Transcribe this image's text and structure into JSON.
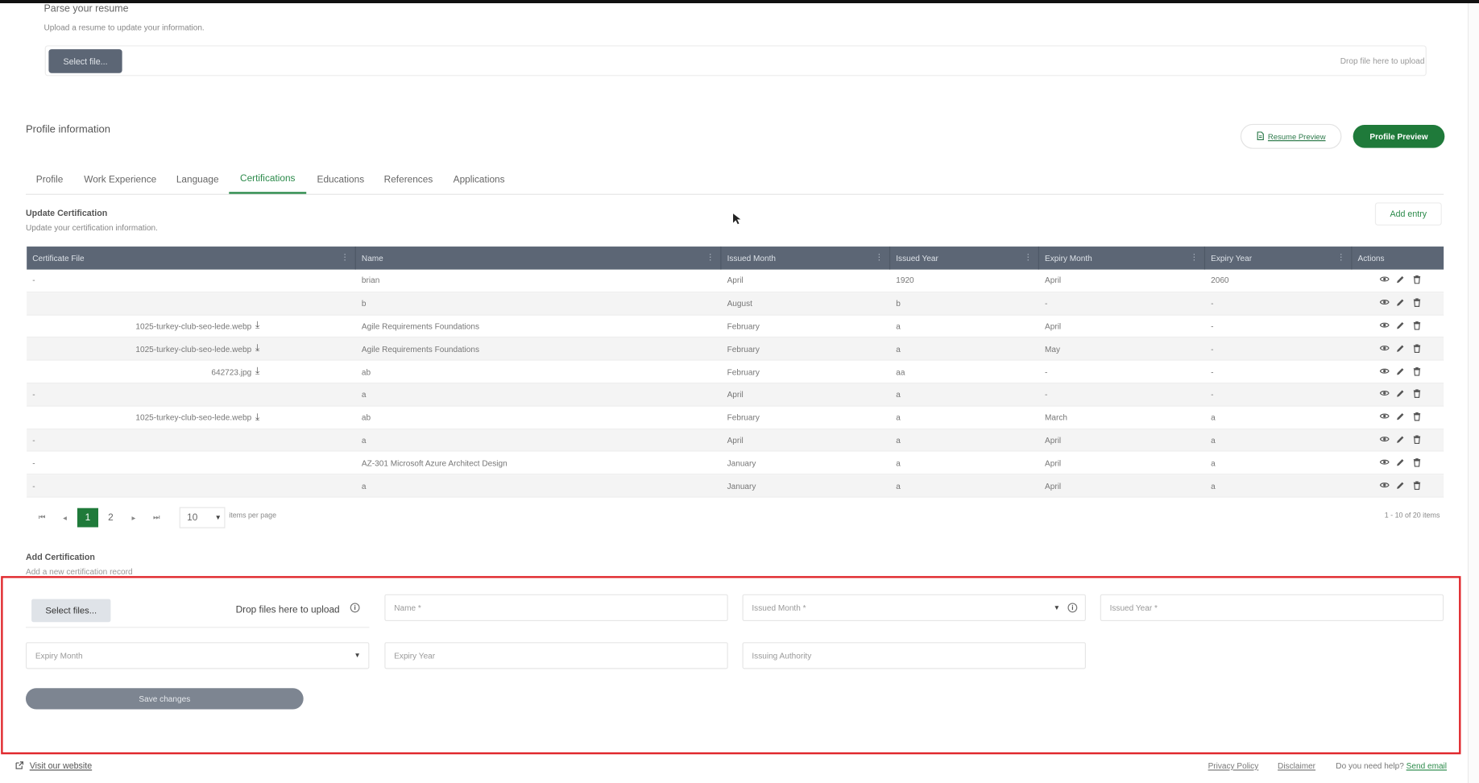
{
  "parse": {
    "title": "Parse your resume",
    "subtitle": "Upload a resume to update your information.",
    "select_label": "Select file...",
    "drop_label": "Drop file here to upload"
  },
  "profile": {
    "title": "Profile information",
    "resume_preview": "Resume Preview",
    "profile_preview": "Profile Preview"
  },
  "tabs": [
    "Profile",
    "Work Experience",
    "Language",
    "Certifications",
    "Educations",
    "References",
    "Applications"
  ],
  "active_tab": "Certifications",
  "update": {
    "title": "Update Certification",
    "subtitle": "Update your certification information.",
    "add_entry": "Add entry"
  },
  "table": {
    "columns": [
      "Certificate File",
      "Name",
      "Issued Month",
      "Issued Year",
      "Expiry Month",
      "Expiry Year",
      "Actions"
    ],
    "rows": [
      {
        "file": "-",
        "name": "brian",
        "issued_month": "April",
        "issued_year": "1920",
        "expiry_month": "April",
        "expiry_year": "2060"
      },
      {
        "file": "",
        "name": "b",
        "issued_month": "August",
        "issued_year": "b",
        "expiry_month": "-",
        "expiry_year": "-"
      },
      {
        "file": "1025-turkey-club-seo-lede.webp",
        "name": "Agile Requirements Foundations",
        "issued_month": "February",
        "issued_year": "a",
        "expiry_month": "April",
        "expiry_year": "-"
      },
      {
        "file": "1025-turkey-club-seo-lede.webp",
        "name": "Agile Requirements Foundations",
        "issued_month": "February",
        "issued_year": "a",
        "expiry_month": "May",
        "expiry_year": "-"
      },
      {
        "file": "642723.jpg",
        "name": "ab",
        "issued_month": "February",
        "issued_year": "aa",
        "expiry_month": "-",
        "expiry_year": "-"
      },
      {
        "file": "-",
        "name": "a",
        "issued_month": "April",
        "issued_year": "a",
        "expiry_month": "-",
        "expiry_year": "-"
      },
      {
        "file": "1025-turkey-club-seo-lede.webp",
        "name": "ab",
        "issued_month": "February",
        "issued_year": "a",
        "expiry_month": "March",
        "expiry_year": "a"
      },
      {
        "file": "-",
        "name": "a",
        "issued_month": "April",
        "issued_year": "a",
        "expiry_month": "April",
        "expiry_year": "a"
      },
      {
        "file": "-",
        "name": "AZ-301 Microsoft Azure Architect Design",
        "issued_month": "January",
        "issued_year": "a",
        "expiry_month": "April",
        "expiry_year": "a"
      },
      {
        "file": "-",
        "name": "a",
        "issued_month": "January",
        "issued_year": "a",
        "expiry_month": "April",
        "expiry_year": "a"
      }
    ],
    "icons": [
      "eye-icon",
      "pencil-icon",
      "trash-icon",
      "download-icon"
    ]
  },
  "pager": {
    "pages": [
      "1",
      "2"
    ],
    "current_page": "1",
    "per_page": "10",
    "per_page_label": "items per page",
    "range": "1 - 10 of 20 items"
  },
  "add": {
    "title": "Add Certification",
    "subtitle": "Add a new certification record",
    "select_files": "Select files...",
    "drop_files": "Drop files here to upload",
    "name_placeholder": "Name *",
    "issued_month_placeholder": "Issued Month *",
    "issued_year_placeholder": "Issued Year *",
    "expiry_month_placeholder": "Expiry Month",
    "expiry_year_placeholder": "Expiry Year",
    "issuing_authority_placeholder": "Issuing Authority",
    "save": "Save changes"
  },
  "footer": {
    "visit": "Visit our website",
    "privacy": "Privacy Policy",
    "disclaimer": "Disclaimer",
    "help": "Do you need help?",
    "send_email": "Send email"
  },
  "colors": {
    "accent_green": "#1f7a3a",
    "grid_header": "#5c6675",
    "highlight_red": "#e0262b"
  }
}
